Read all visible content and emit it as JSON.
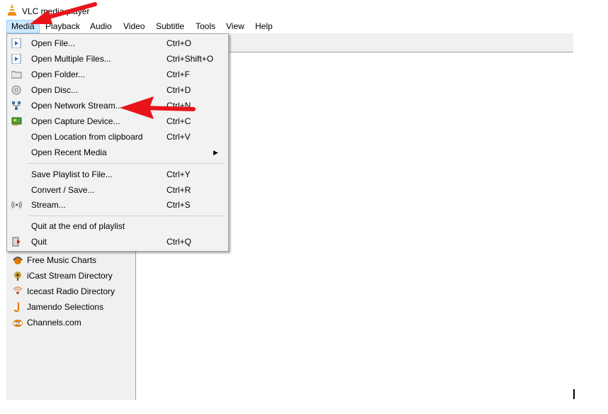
{
  "window": {
    "title": "VLC media player"
  },
  "menubar": [
    "Media",
    "Playback",
    "Audio",
    "Video",
    "Subtitle",
    "Tools",
    "View",
    "Help"
  ],
  "media_menu": {
    "items": [
      {
        "label": "Open File...",
        "shortcut": "Ctrl+O",
        "icon": "play-file-icon"
      },
      {
        "label": "Open Multiple Files...",
        "shortcut": "Ctrl+Shift+O",
        "icon": "play-file-icon"
      },
      {
        "label": "Open Folder...",
        "shortcut": "Ctrl+F",
        "icon": "folder-icon"
      },
      {
        "label": "Open Disc...",
        "shortcut": "Ctrl+D",
        "icon": "disc-icon"
      },
      {
        "label": "Open Network Stream...",
        "shortcut": "Ctrl+N",
        "icon": "network-icon"
      },
      {
        "label": "Open Capture Device...",
        "shortcut": "Ctrl+C",
        "icon": "capture-card-icon"
      },
      {
        "label": "Open Location from clipboard",
        "shortcut": "Ctrl+V",
        "icon": ""
      },
      {
        "label": "Open Recent Media",
        "shortcut": "",
        "icon": "",
        "submenu": true
      },
      {
        "label": "Save Playlist to File...",
        "shortcut": "Ctrl+Y",
        "icon": ""
      },
      {
        "label": "Convert / Save...",
        "shortcut": "Ctrl+R",
        "icon": ""
      },
      {
        "label": "Stream...",
        "shortcut": "Ctrl+S",
        "icon": "stream-icon"
      },
      {
        "label": "Quit at the end of playlist",
        "shortcut": "",
        "icon": ""
      },
      {
        "label": "Quit",
        "shortcut": "Ctrl+Q",
        "icon": "quit-icon"
      }
    ],
    "submenu_arrow": "▶"
  },
  "sidebar": {
    "items": [
      {
        "label": "Free Music Charts",
        "icon": "music-charts-icon"
      },
      {
        "label": "iCast Stream Directory",
        "icon": "icast-icon"
      },
      {
        "label": "Icecast Radio Directory",
        "icon": "icecast-icon"
      },
      {
        "label": "Jamendo Selections",
        "icon": "jamendo-icon"
      },
      {
        "label": "Channels.com",
        "icon": "channels-icon"
      }
    ]
  },
  "colors": {
    "annotation_arrow": "#e8141b",
    "menu_highlight": "#cce8ff",
    "vlc_orange": "#f28a00"
  }
}
